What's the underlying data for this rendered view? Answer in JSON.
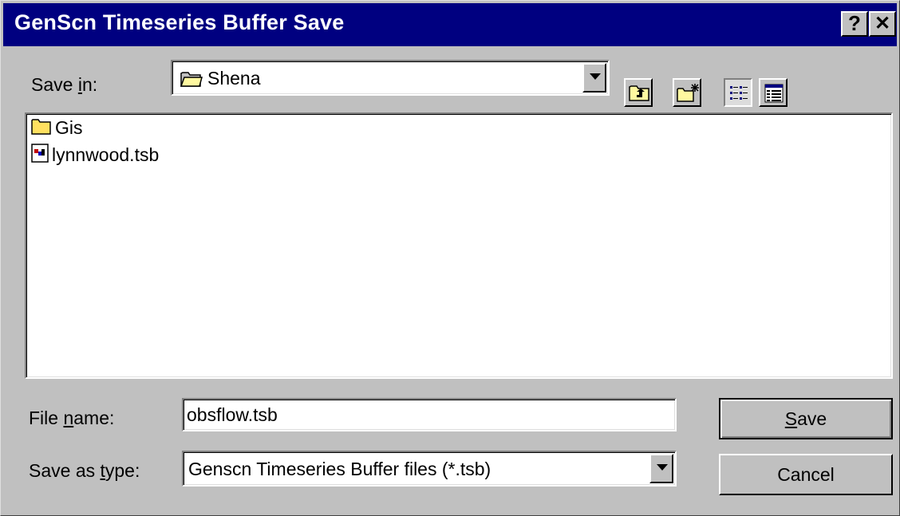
{
  "window": {
    "title": "GenScn Timeseries Buffer Save",
    "help_label": "?",
    "close_label": "✕"
  },
  "save_in": {
    "label_pre": "Save ",
    "label_key": "i",
    "label_post": "n:",
    "value": "Shena"
  },
  "toolbar": {
    "up_folder_icon": "up-one-level-icon",
    "new_folder_icon": "new-folder-icon",
    "list_view_icon": "list-view-icon",
    "details_view_icon": "details-view-icon"
  },
  "files": [
    {
      "name": "Gis",
      "icon": "folder-icon"
    },
    {
      "name": "lynnwood.tsb",
      "icon": "file-icon"
    }
  ],
  "file_name": {
    "label_pre": "File ",
    "label_key": "n",
    "label_post": "ame:",
    "value": "obsflow.tsb"
  },
  "save_as_type": {
    "label_pre": "Save as ",
    "label_key": "t",
    "label_post": "ype:",
    "value": "Genscn Timeseries Buffer files (*.tsb)"
  },
  "buttons": {
    "save_key": "S",
    "save_rest": "ave",
    "cancel": "Cancel"
  }
}
